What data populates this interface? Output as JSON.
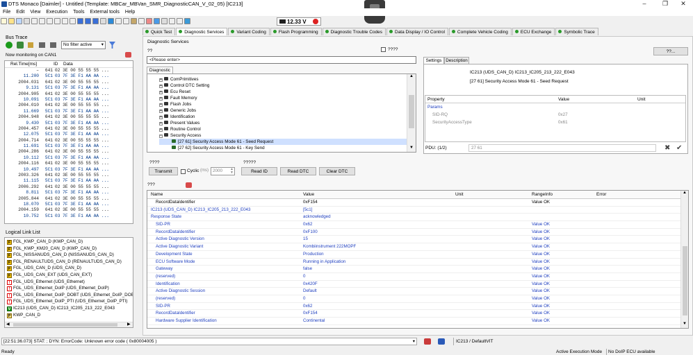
{
  "window": {
    "title": "DTS Monaco [Daimler] - Untitled (Template: MBCar_MBVan_SMR_DiagnosticCAN_V_02_05) [IC213]",
    "min": "–",
    "max": "❐",
    "close": "✕"
  },
  "menu": [
    "File",
    "Edit",
    "View",
    "Execution",
    "Tools",
    "External tools",
    "Help"
  ],
  "toolbar": {
    "voltage": "12.33 V"
  },
  "bus_trace": {
    "title": "Bus Trace",
    "filter": "No filter active",
    "monitoring": "Now monitoring on CAN1",
    "headers": {
      "time": "Rel.Time[ms]",
      "id": "ID",
      "data": "Data"
    },
    "rows": [
      {
        "t": "–",
        "id": "641",
        "d": "02 3E 00 55 55 55 ..."
      },
      {
        "t": "11.200",
        "id": "5C1",
        "d": "03 7F 3E F1 AA AA ..."
      },
      {
        "t": "2004.031",
        "id": "641",
        "d": "02 3E 00 55 55 55 ..."
      },
      {
        "t": "9.131",
        "id": "5C1",
        "d": "03 7F 3E F1 AA AA ..."
      },
      {
        "t": "2004.905",
        "id": "641",
        "d": "02 3E 00 55 55 55 ..."
      },
      {
        "t": "10.091",
        "id": "5C1",
        "d": "03 7F 3E F1 AA AA ..."
      },
      {
        "t": "2004.010",
        "id": "641",
        "d": "02 3E 00 55 55 55 ..."
      },
      {
        "t": "11.669",
        "id": "5C1",
        "d": "03 7F 3E F1 AA AA ..."
      },
      {
        "t": "2004.948",
        "id": "641",
        "d": "02 3E 00 55 55 55 ..."
      },
      {
        "t": "9.430",
        "id": "5C1",
        "d": "03 7F 3E F1 AA AA ..."
      },
      {
        "t": "2004.457",
        "id": "641",
        "d": "02 3E 00 55 55 55 ..."
      },
      {
        "t": "12.075",
        "id": "5C1",
        "d": "03 7F 3E F1 AA AA ..."
      },
      {
        "t": "2004.714",
        "id": "641",
        "d": "02 3E 00 55 55 55 ..."
      },
      {
        "t": "11.691",
        "id": "5C1",
        "d": "03 7F 3E F1 AA AA ..."
      },
      {
        "t": "2004.286",
        "id": "641",
        "d": "02 3E 00 55 55 55 ..."
      },
      {
        "t": "10.112",
        "id": "5C1",
        "d": "03 7F 3E F1 AA AA ..."
      },
      {
        "t": "2004.116",
        "id": "641",
        "d": "02 3E 00 55 55 55 ..."
      },
      {
        "t": "10.497",
        "id": "5C1",
        "d": "03 7F 3E F1 AA AA ..."
      },
      {
        "t": "2003.326",
        "id": "641",
        "d": "02 3E 00 55 55 55 ..."
      },
      {
        "t": "11.115",
        "id": "5C1",
        "d": "03 7F 3E F1 AA AA ..."
      },
      {
        "t": "2006.292",
        "id": "641",
        "d": "02 3E 00 55 55 55 ..."
      },
      {
        "t": "8.811",
        "id": "5C1",
        "d": "03 7F 3E F1 AA AA ..."
      },
      {
        "t": "2005.844",
        "id": "641",
        "d": "02 3E 00 55 55 55 ..."
      },
      {
        "t": "18.070",
        "id": "5C1",
        "d": "03 7F 3E F1 AA AA ..."
      },
      {
        "t": "2004.159",
        "id": "641",
        "d": "02 3E 00 55 55 55 ..."
      },
      {
        "t": "10.752",
        "id": "5C1",
        "d": "03 7F 3E F1 AA AA ..."
      }
    ]
  },
  "logical_links": {
    "title": "Logical Link List",
    "items": [
      {
        "icon": "F",
        "label": "FGL_KWP_CAN_D (KWP_CAN_D)"
      },
      {
        "icon": "F",
        "label": "FGL_KWP_KM20_CAN_D (KWP_CAN_D)"
      },
      {
        "icon": "F",
        "label": "FGL_NISSANUDS_CAN_D (NISSANUDS_CAN_D)"
      },
      {
        "icon": "F",
        "label": "FGL_RENAULTUDS_CAN_D (RENAULTUDS_CAN_D)"
      },
      {
        "icon": "F",
        "label": "FGL_UDS_CAN_D (UDS_CAN_D)"
      },
      {
        "icon": "F",
        "label": "FGL_UDS_CAN_EXT (UDS_CAN_EXT)"
      },
      {
        "icon": "W",
        "label": "FGL_UDS_Ethernet (UDS_Ethernet)"
      },
      {
        "icon": "W",
        "label": "FGL_UDS_Ethernet_DoIP (UDS_Ethernet_DoIP)"
      },
      {
        "icon": "W",
        "label": "FGL_UDS_Ethernet_DoIP_DOBT (UDS_Ethernet_DoIP_DOBT)"
      },
      {
        "icon": "W",
        "label": "FGL_UDS_Ethernet_DoIP_PTI (UDS_Ethernet_DoIP_PTI)"
      },
      {
        "icon": "V",
        "label": "IC213 (UDS_CAN_D) IC213_IC205_213_222_E043"
      },
      {
        "icon": "P",
        "label": "KWP_CAN_D"
      }
    ]
  },
  "tabs": [
    "Quick Test",
    "Diagnostic Services",
    "Variant Coding",
    "Flash Programming",
    "Diagnostic Trouble Codes",
    "Data Display / IO Control",
    "Complete Vehicle Coding",
    "ECU Exchange",
    "Symbolic Trace"
  ],
  "services": {
    "title": "Diagnostic Services",
    "qq": "??",
    "checkbox_label": "????",
    "dots_button": "??...",
    "placeholder": "<Please enter>",
    "tree_tab": "Diagnostic",
    "tree": [
      "ComPrimitives",
      "Control DTC Setting",
      "Ecu Reset",
      "Fault Memory",
      "Flash Jobs",
      "Generic Jobs",
      "Identification",
      "Present Values",
      "Routine Control",
      "Security Access"
    ],
    "tree_children": [
      "[27 61] Security Access Mode 61 - Seed Request",
      "[27 62] Security Access Mode 61 - Key Send"
    ]
  },
  "settings": {
    "tabs": [
      "Settings",
      "Description"
    ],
    "ecu": "IC213 (UDS_CAN_D) IC213_IC205_213_222_E043",
    "service": "[27 61] Security Access Mode 61 - Seed Request",
    "headers": {
      "property": "Property",
      "value": "Value",
      "unit": "Unit"
    },
    "params_label": "Params",
    "params": [
      {
        "name": "SID-RQ",
        "value": "0x27"
      },
      {
        "name": "SecurityAccessType",
        "value": "0x61"
      }
    ],
    "pdu_label": "PDU: (1/2)",
    "pdu_value": "27 61"
  },
  "controls": {
    "q4": "????",
    "transmit": "Transmit",
    "cyclic": "Cyclic",
    "ms": "(ms)",
    "interval": "2000",
    "q5": "?????",
    "read_id": "Read ID",
    "read_dtc": "Read DTC",
    "clear_dtc": "Clear DTC",
    "q3": "???"
  },
  "results": {
    "headers": {
      "name": "Name",
      "value": "Value",
      "unit": "Unit",
      "range": "RangeInfo",
      "error": "Error"
    },
    "rows": [
      {
        "n": "RecordDataIdentifier",
        "v": "0xF154",
        "r": "Value OK",
        "c": "dark",
        "ind": 1
      },
      {
        "n": "IC213 (UDS_CAN_D) IC213_IC205_213_222_E043",
        "v": "[5c1]",
        "r": "",
        "c": "blue",
        "ind": 0
      },
      {
        "n": "Response State",
        "v": "acknowledged",
        "r": "",
        "c": "blue",
        "ind": 0
      },
      {
        "n": "SID-PR",
        "v": "0x62",
        "r": "Value OK",
        "c": "blue",
        "ind": 1
      },
      {
        "n": "RecordDataIdentifier",
        "v": "0xF100",
        "r": "Value OK",
        "c": "blue",
        "ind": 1
      },
      {
        "n": "Active Diagnostic Version",
        "v": "15",
        "r": "Value OK",
        "c": "blue",
        "ind": 1
      },
      {
        "n": "Active Diagnostic Variant",
        "v": "Kombiinstrument 222MOPF",
        "r": "Value OK",
        "c": "blue",
        "ind": 1
      },
      {
        "n": "Development State",
        "v": "Production",
        "r": "Value OK",
        "c": "blue",
        "ind": 1
      },
      {
        "n": "ECU Software Mode",
        "v": "Running in Application",
        "r": "Value OK",
        "c": "blue",
        "ind": 1
      },
      {
        "n": "Gateway",
        "v": "false",
        "r": "Value OK",
        "c": "blue",
        "ind": 1
      },
      {
        "n": "(reserved)",
        "v": "0",
        "r": "Value OK",
        "c": "blue",
        "ind": 1
      },
      {
        "n": "Identification",
        "v": "0x420F",
        "r": "Value OK",
        "c": "blue",
        "ind": 1
      },
      {
        "n": "Active Diagnostic Session",
        "v": "Default",
        "r": "Value OK",
        "c": "blue",
        "ind": 1
      },
      {
        "n": "(reserved)",
        "v": "0",
        "r": "Value OK",
        "c": "blue",
        "ind": 1
      },
      {
        "n": "SID-PR",
        "v": "0x62",
        "r": "Value OK",
        "c": "blue",
        "ind": 1
      },
      {
        "n": "RecordDataIdentifier",
        "v": "0xF154",
        "r": "Value OK",
        "c": "blue",
        "ind": 1
      },
      {
        "n": "Hardware Supplier Identification",
        "v": "Continental",
        "r": "Value OK",
        "c": "blue",
        "ind": 1
      }
    ]
  },
  "bottom": {
    "log": "[22:51:36.073] STAT: ; DYN:  ErrorCode: Unknown error code  ( 0x80004005 )",
    "link": "IC213 / DefaultVIT"
  },
  "status": {
    "left": "Ready",
    "mode": "Active Execution Mode",
    "doip": "No DoIP ECU available"
  }
}
